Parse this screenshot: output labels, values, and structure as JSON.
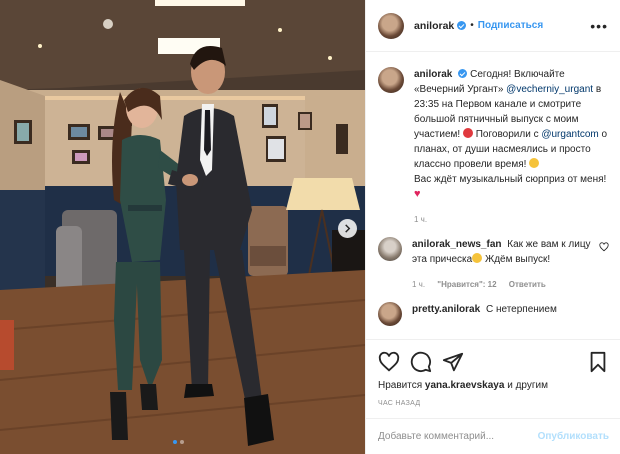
{
  "header": {
    "username": "anilorak",
    "follow_label": "Подписаться",
    "separator": "•",
    "more_label": "•••"
  },
  "caption": {
    "username": "anilorak",
    "line1": "Сегодня! Включайте «Вечерний Ургант»",
    "mention1": "@vecherniy_urgant",
    "line2": " в 23:35 на Первом канале и смотрите большой пятничный выпуск с моим участием! ",
    "line3": " Поговорили с ",
    "mention2": "@urgantcom",
    "line4": " о планах, от души насмеялись и просто классно провели время! ",
    "line5": "Вас ждёт музыкальный сюрприз от меня! ",
    "time": "1 ч."
  },
  "comments": [
    {
      "username": "anilorak_news_fan",
      "text": "Как же вам к лицу эта прическа",
      "text_after": " Ждём выпуск!",
      "time": "1 ч.",
      "likes": "\"Нравится\": 12",
      "reply": "Ответить"
    },
    {
      "username": "pretty.anilorak",
      "text": "С нетерпением"
    }
  ],
  "likes": {
    "prefix": "Нравится ",
    "user": "yana.kraevskaya",
    "suffix": " и другим"
  },
  "timestamp": "час назад",
  "add_comment": {
    "placeholder": "Добавьте комментарий...",
    "publish_label": "Опубликовать"
  },
  "icons": {
    "like": "heart-icon",
    "comment": "comment-icon",
    "share": "paper-plane-icon",
    "save": "bookmark-icon",
    "next": "chevron-right-icon"
  },
  "colors": {
    "accent": "#3897f0",
    "publish_disabled": "#b2dffc",
    "muted": "#8e8e8e",
    "mention": "#00376b"
  }
}
